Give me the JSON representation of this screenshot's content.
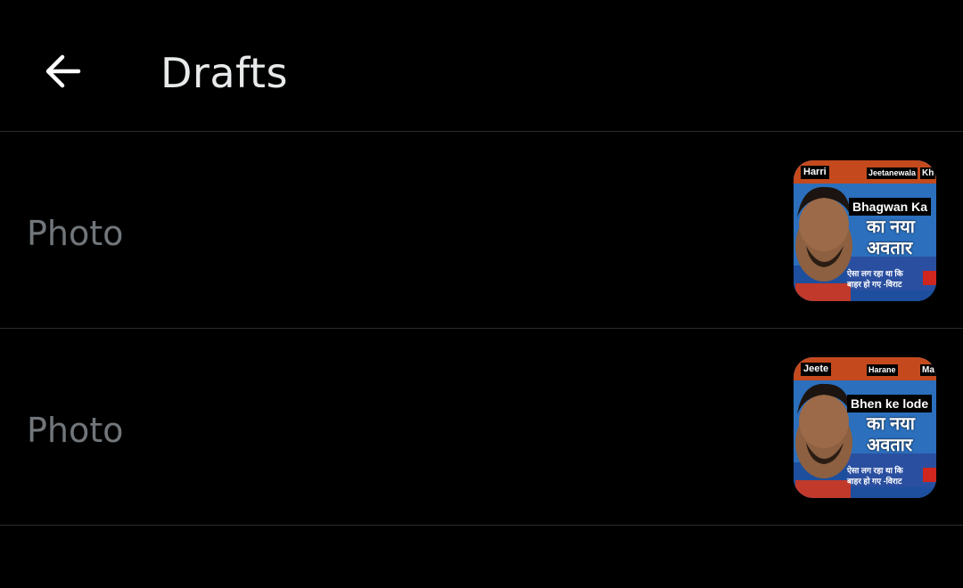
{
  "header": {
    "back_icon": "arrow-left-icon",
    "title": "Drafts"
  },
  "drafts": [
    {
      "label": "Photo",
      "thumbnail": {
        "top_left": "Harri",
        "top_mid": "Jeetanewala",
        "top_right": "Kh",
        "caption": "Bhagwan Ka",
        "line1": "का नया",
        "line2": "अवतार",
        "small1": "ऐसा लग रहा था कि",
        "small2": "बाहर हो गए -विराट"
      }
    },
    {
      "label": "Photo",
      "thumbnail": {
        "top_left": "Jeete",
        "top_mid": "Harane",
        "top_right": "Ma",
        "caption": "Bhen ke lode",
        "line1": "का नया",
        "line2": "अवतार",
        "small1": "ऐसा लग रहा था कि",
        "small2": "बाहर हो गए -विराट"
      }
    }
  ],
  "colors": {
    "background": "#000000",
    "title": "#e7e9ea",
    "label": "#71767b",
    "divider": "#2a2d31"
  }
}
